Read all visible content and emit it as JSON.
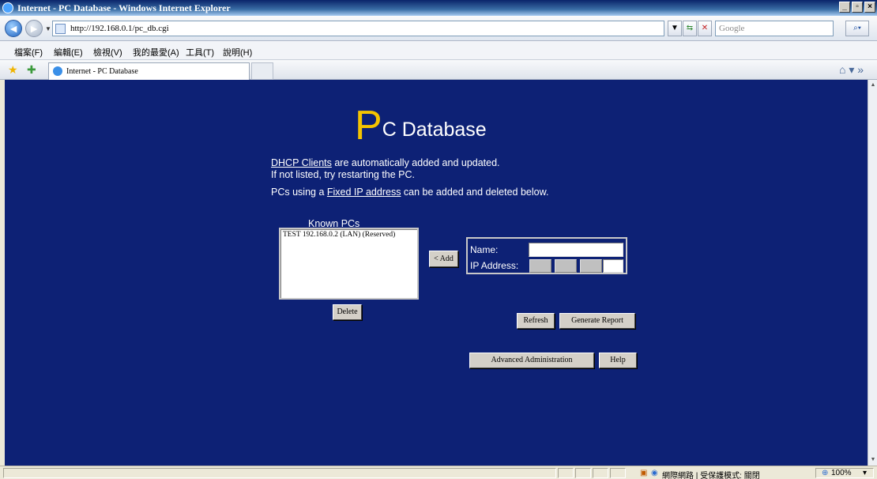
{
  "window": {
    "title": "Internet - PC Database - Windows Internet Explorer",
    "buttons": {
      "minimize": "_",
      "maximize": "▫",
      "close": "×"
    }
  },
  "address_bar": {
    "url": "http://192.168.0.1/pc_db.cgi",
    "search_placeholder": "Google"
  },
  "menu": {
    "items": [
      "檔案(F)",
      "編輯(E)",
      "檢視(V)",
      "我的最愛(A)",
      "工具(T)",
      "說明(H)"
    ]
  },
  "tab": {
    "label": "Internet - PC Database"
  },
  "page": {
    "heading_big": "P",
    "heading_rest": "C Database",
    "line1_link": "DHCP Clients",
    "line1_rest": " are automatically added and updated.",
    "line2": "If not listed, try restarting the PC.",
    "line3_prefix": "PCs using a ",
    "line3_link": "Fixed IP address",
    "line3_suffix": " can be added and deleted below.",
    "known_pcs_label": "Known PCs",
    "known_pcs": [
      "TEST 192.168.0.2 (LAN) (Reserved)"
    ],
    "add_button": "< Add",
    "delete_button": "Delete",
    "name_label": "Name:",
    "ip_label": "IP Address:",
    "refresh_button": "Refresh",
    "report_button": "Generate Report",
    "advanced_button": "Advanced Administration",
    "help_button": "Help"
  },
  "status_bar": {
    "zone": "網際網路 | 受保護模式: 關閉",
    "zoom": "100%"
  },
  "colors": {
    "page_background": "#0d2175",
    "heading_accent": "#f5c400"
  }
}
